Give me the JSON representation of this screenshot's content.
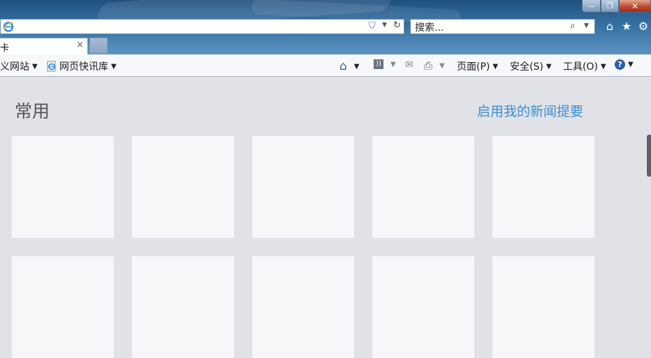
{
  "window": {
    "minimize": "—",
    "restore": "❐",
    "close": "✕"
  },
  "address_bar": {
    "value": "",
    "icons": [
      "ie-logo-icon",
      "shield-icon",
      "chevron-down-icon",
      "refresh-icon"
    ]
  },
  "search": {
    "placeholder": "搜索...",
    "icons": [
      "magnifier-icon",
      "chevron-down-icon"
    ]
  },
  "nav_icons": [
    "home-icon",
    "star-icon",
    "gear-icon"
  ],
  "tab": {
    "label": "卡",
    "close": "×"
  },
  "command_bar": {
    "favorites_site": "义网站",
    "web_slice": "网页快讯库",
    "page": "页面(P)",
    "safety": "安全(S)",
    "tools": "工具(O)",
    "help_icon": "help-icon"
  },
  "content": {
    "section_title": "常用",
    "news_link": "启用我的新闻提要",
    "tiles": [
      "",
      "",
      "",
      "",
      "",
      "",
      "",
      "",
      "",
      ""
    ]
  },
  "colors": {
    "frame": "#2d6597",
    "content_bg": "#e1e2e7",
    "tile_bg": "#f7f7f9",
    "link": "#3c8fd1"
  }
}
